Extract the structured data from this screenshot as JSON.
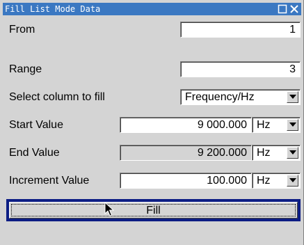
{
  "window": {
    "title": "Fill List Mode Data"
  },
  "rows": {
    "from": {
      "label": "From",
      "value": "1"
    },
    "range": {
      "label": "Range",
      "value": "3"
    },
    "select_column": {
      "label": "Select column to fill",
      "value": "Frequency/Hz"
    },
    "start_value": {
      "label": "Start Value",
      "value": "9 000.000",
      "unit": "Hz"
    },
    "end_value": {
      "label": "End Value",
      "value": "9 200.000",
      "unit": "Hz"
    },
    "increment_value": {
      "label": "Increment Value",
      "value": "100.000",
      "unit": "Hz"
    }
  },
  "fill_button": {
    "label": "Fill"
  },
  "icons": {
    "restore": "restore-icon",
    "close": "close-icon",
    "dropdown": "chevron-down-icon",
    "cursor": "mouse-pointer-icon"
  }
}
